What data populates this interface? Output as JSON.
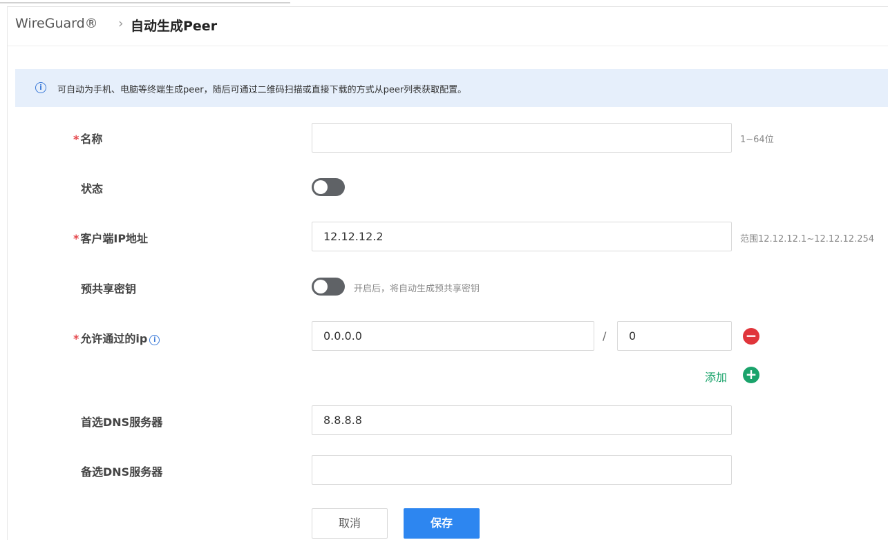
{
  "breadcrumb": {
    "root": "WireGuard®",
    "separator": "›",
    "current": "自动生成Peer"
  },
  "notice": {
    "icon": "info-circle-icon",
    "text": "可自动为手机、电脑等终端生成peer，随后可通过二维码扫描或直接下载的方式从peer列表获取配置。"
  },
  "form": {
    "required_mark": "*",
    "name": {
      "label": "名称",
      "value": "",
      "hint": "1~64位"
    },
    "status": {
      "label": "状态",
      "enabled": false
    },
    "client_ip": {
      "label": "客户端IP地址",
      "value": "12.12.12.2",
      "hint": "范围12.12.12.1~12.12.12.254"
    },
    "preshared_key": {
      "label": "预共享密钥",
      "enabled": false,
      "hint": "开启后，将自动生成预共享密钥"
    },
    "allowed_ip": {
      "label": "允许通过的ip",
      "ip": "0.0.0.0",
      "separator": "/",
      "mask": "0"
    },
    "add_label": "添加",
    "primary_dns": {
      "label": "首选DNS服务器",
      "value": "8.8.8.8"
    },
    "secondary_dns": {
      "label": "备选DNS服务器",
      "value": ""
    }
  },
  "buttons": {
    "cancel": "取消",
    "save": "保存"
  },
  "colors": {
    "primary": "#2d86f0",
    "danger": "#e0353b",
    "success": "#1aa36b",
    "notice_bg": "#e6effb",
    "toggle_off": "#5f6266"
  }
}
